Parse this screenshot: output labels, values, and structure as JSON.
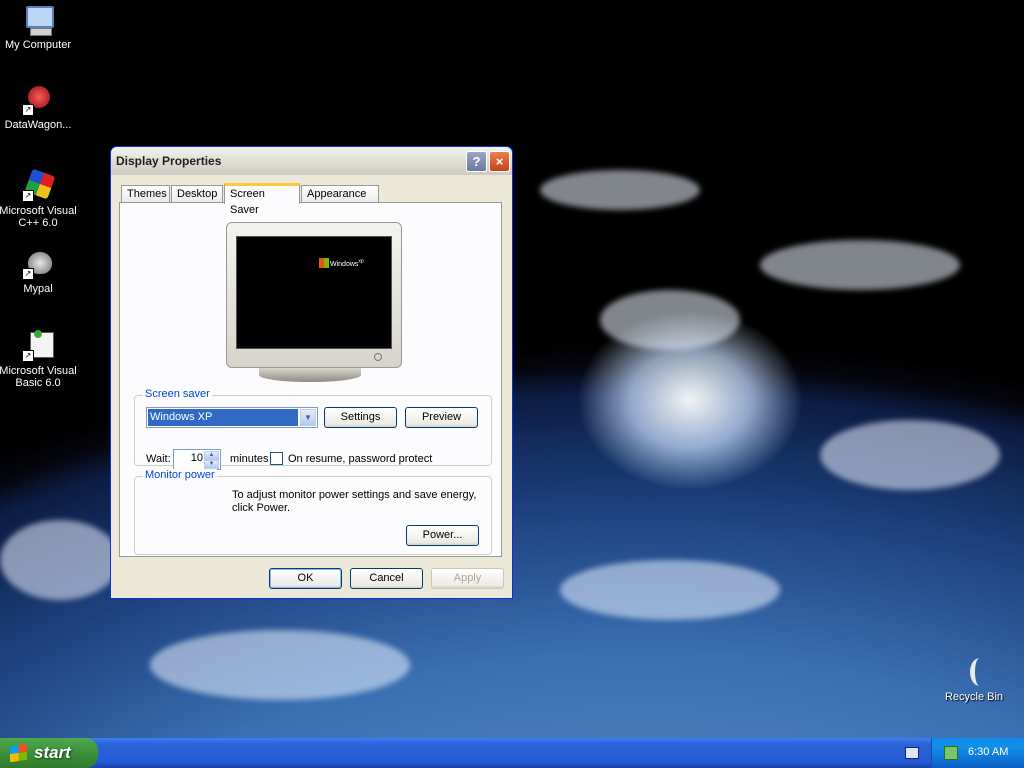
{
  "desktop": {
    "icons": [
      {
        "label": "My Computer",
        "glyph": "computer-icon"
      },
      {
        "label": "DataWagon...",
        "glyph": "datawagon-icon"
      },
      {
        "label": "Microsoft Visual C++ 6.0",
        "glyph": "visual-cpp-icon"
      },
      {
        "label": "Mypal",
        "glyph": "mypal-icon"
      },
      {
        "label": "Microsoft Visual Basic 6.0",
        "glyph": "visual-basic-icon"
      },
      {
        "label": "Recycle Bin",
        "glyph": "recycle-bin-icon"
      }
    ]
  },
  "window": {
    "title": "Display Properties",
    "help_glyph": "?",
    "close_glyph": "×",
    "tabs": [
      "Themes",
      "Desktop",
      "Screen Saver",
      "Appearance"
    ],
    "active_tab": "Screen Saver",
    "preview_logo": "Windows",
    "preview_logo_sup": "xp",
    "screensaver": {
      "group_label": "Screen saver",
      "selected": "Windows XP",
      "settings_label": "Settings",
      "preview_label": "Preview",
      "wait_label": "Wait:",
      "wait_value": "10",
      "minutes_label": "minutes",
      "password_label": "On resume, password protect",
      "password_checked": false
    },
    "monitor_power": {
      "group_label": "Monitor power",
      "text": "To adjust monitor power settings and save energy, click Power.",
      "power_label": "Power..."
    },
    "buttons": {
      "ok": "OK",
      "cancel": "Cancel",
      "apply": "Apply"
    }
  },
  "taskbar": {
    "start_label": "start",
    "clock": "6:30 AM"
  },
  "colors": {
    "accent": "#0046d5",
    "selection": "#316ac5",
    "taskbar": "#235bd6",
    "start": "#3c8f3a"
  }
}
